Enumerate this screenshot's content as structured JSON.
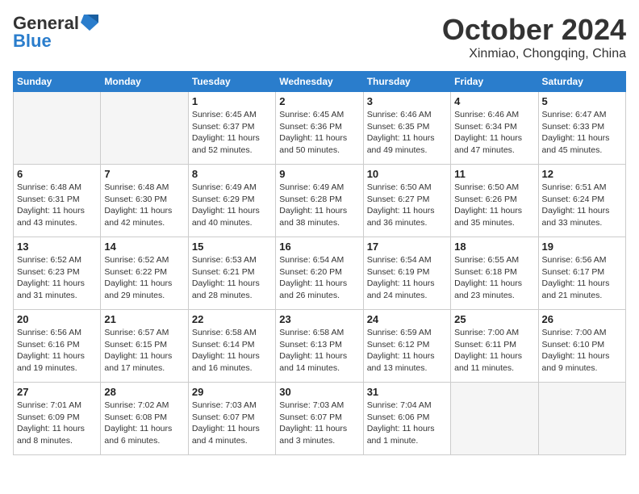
{
  "header": {
    "logo_line1": "General",
    "logo_line2": "Blue",
    "month_title": "October 2024",
    "location": "Xinmiao, Chongqing, China"
  },
  "weekdays": [
    "Sunday",
    "Monday",
    "Tuesday",
    "Wednesday",
    "Thursday",
    "Friday",
    "Saturday"
  ],
  "weeks": [
    [
      {
        "day": "",
        "empty": true
      },
      {
        "day": "",
        "empty": true
      },
      {
        "day": "1",
        "lines": [
          "Sunrise: 6:45 AM",
          "Sunset: 6:37 PM",
          "Daylight: 11 hours",
          "and 52 minutes."
        ]
      },
      {
        "day": "2",
        "lines": [
          "Sunrise: 6:45 AM",
          "Sunset: 6:36 PM",
          "Daylight: 11 hours",
          "and 50 minutes."
        ]
      },
      {
        "day": "3",
        "lines": [
          "Sunrise: 6:46 AM",
          "Sunset: 6:35 PM",
          "Daylight: 11 hours",
          "and 49 minutes."
        ]
      },
      {
        "day": "4",
        "lines": [
          "Sunrise: 6:46 AM",
          "Sunset: 6:34 PM",
          "Daylight: 11 hours",
          "and 47 minutes."
        ]
      },
      {
        "day": "5",
        "lines": [
          "Sunrise: 6:47 AM",
          "Sunset: 6:33 PM",
          "Daylight: 11 hours",
          "and 45 minutes."
        ]
      }
    ],
    [
      {
        "day": "6",
        "lines": [
          "Sunrise: 6:48 AM",
          "Sunset: 6:31 PM",
          "Daylight: 11 hours",
          "and 43 minutes."
        ]
      },
      {
        "day": "7",
        "lines": [
          "Sunrise: 6:48 AM",
          "Sunset: 6:30 PM",
          "Daylight: 11 hours",
          "and 42 minutes."
        ]
      },
      {
        "day": "8",
        "lines": [
          "Sunrise: 6:49 AM",
          "Sunset: 6:29 PM",
          "Daylight: 11 hours",
          "and 40 minutes."
        ]
      },
      {
        "day": "9",
        "lines": [
          "Sunrise: 6:49 AM",
          "Sunset: 6:28 PM",
          "Daylight: 11 hours",
          "and 38 minutes."
        ]
      },
      {
        "day": "10",
        "lines": [
          "Sunrise: 6:50 AM",
          "Sunset: 6:27 PM",
          "Daylight: 11 hours",
          "and 36 minutes."
        ]
      },
      {
        "day": "11",
        "lines": [
          "Sunrise: 6:50 AM",
          "Sunset: 6:26 PM",
          "Daylight: 11 hours",
          "and 35 minutes."
        ]
      },
      {
        "day": "12",
        "lines": [
          "Sunrise: 6:51 AM",
          "Sunset: 6:24 PM",
          "Daylight: 11 hours",
          "and 33 minutes."
        ]
      }
    ],
    [
      {
        "day": "13",
        "lines": [
          "Sunrise: 6:52 AM",
          "Sunset: 6:23 PM",
          "Daylight: 11 hours",
          "and 31 minutes."
        ]
      },
      {
        "day": "14",
        "lines": [
          "Sunrise: 6:52 AM",
          "Sunset: 6:22 PM",
          "Daylight: 11 hours",
          "and 29 minutes."
        ]
      },
      {
        "day": "15",
        "lines": [
          "Sunrise: 6:53 AM",
          "Sunset: 6:21 PM",
          "Daylight: 11 hours",
          "and 28 minutes."
        ]
      },
      {
        "day": "16",
        "lines": [
          "Sunrise: 6:54 AM",
          "Sunset: 6:20 PM",
          "Daylight: 11 hours",
          "and 26 minutes."
        ]
      },
      {
        "day": "17",
        "lines": [
          "Sunrise: 6:54 AM",
          "Sunset: 6:19 PM",
          "Daylight: 11 hours",
          "and 24 minutes."
        ]
      },
      {
        "day": "18",
        "lines": [
          "Sunrise: 6:55 AM",
          "Sunset: 6:18 PM",
          "Daylight: 11 hours",
          "and 23 minutes."
        ]
      },
      {
        "day": "19",
        "lines": [
          "Sunrise: 6:56 AM",
          "Sunset: 6:17 PM",
          "Daylight: 11 hours",
          "and 21 minutes."
        ]
      }
    ],
    [
      {
        "day": "20",
        "lines": [
          "Sunrise: 6:56 AM",
          "Sunset: 6:16 PM",
          "Daylight: 11 hours",
          "and 19 minutes."
        ]
      },
      {
        "day": "21",
        "lines": [
          "Sunrise: 6:57 AM",
          "Sunset: 6:15 PM",
          "Daylight: 11 hours",
          "and 17 minutes."
        ]
      },
      {
        "day": "22",
        "lines": [
          "Sunrise: 6:58 AM",
          "Sunset: 6:14 PM",
          "Daylight: 11 hours",
          "and 16 minutes."
        ]
      },
      {
        "day": "23",
        "lines": [
          "Sunrise: 6:58 AM",
          "Sunset: 6:13 PM",
          "Daylight: 11 hours",
          "and 14 minutes."
        ]
      },
      {
        "day": "24",
        "lines": [
          "Sunrise: 6:59 AM",
          "Sunset: 6:12 PM",
          "Daylight: 11 hours",
          "and 13 minutes."
        ]
      },
      {
        "day": "25",
        "lines": [
          "Sunrise: 7:00 AM",
          "Sunset: 6:11 PM",
          "Daylight: 11 hours",
          "and 11 minutes."
        ]
      },
      {
        "day": "26",
        "lines": [
          "Sunrise: 7:00 AM",
          "Sunset: 6:10 PM",
          "Daylight: 11 hours",
          "and 9 minutes."
        ]
      }
    ],
    [
      {
        "day": "27",
        "lines": [
          "Sunrise: 7:01 AM",
          "Sunset: 6:09 PM",
          "Daylight: 11 hours",
          "and 8 minutes."
        ]
      },
      {
        "day": "28",
        "lines": [
          "Sunrise: 7:02 AM",
          "Sunset: 6:08 PM",
          "Daylight: 11 hours",
          "and 6 minutes."
        ]
      },
      {
        "day": "29",
        "lines": [
          "Sunrise: 7:03 AM",
          "Sunset: 6:07 PM",
          "Daylight: 11 hours",
          "and 4 minutes."
        ]
      },
      {
        "day": "30",
        "lines": [
          "Sunrise: 7:03 AM",
          "Sunset: 6:07 PM",
          "Daylight: 11 hours",
          "and 3 minutes."
        ]
      },
      {
        "day": "31",
        "lines": [
          "Sunrise: 7:04 AM",
          "Sunset: 6:06 PM",
          "Daylight: 11 hours",
          "and 1 minute."
        ]
      },
      {
        "day": "",
        "empty": true
      },
      {
        "day": "",
        "empty": true
      }
    ]
  ]
}
